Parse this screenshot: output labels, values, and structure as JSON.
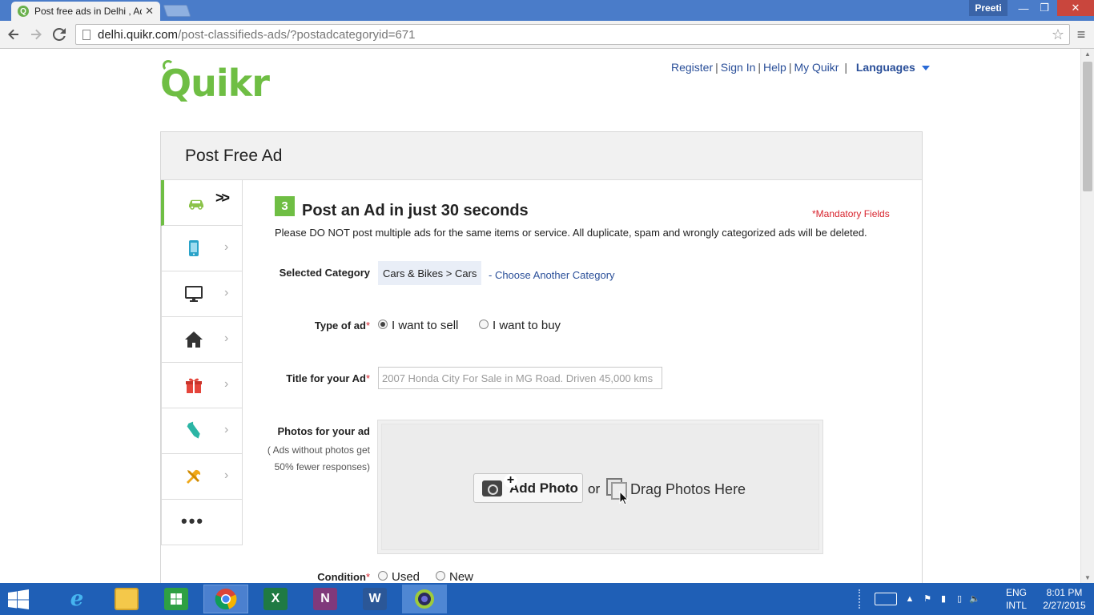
{
  "browser": {
    "tab_title": "Post free ads in Delhi , Adv",
    "tab_favicon_letter": "Q",
    "user_name": "Preeti",
    "url_host": "delhi.quikr.com",
    "url_path": "/post-classifieds-ads/?postadcategoryid=671",
    "window_controls": {
      "minimize": "—",
      "maximize": "❐",
      "close": "✕"
    }
  },
  "header": {
    "logo_text": "Quikr",
    "links": {
      "register": "Register",
      "sign_in": "Sign In",
      "help": "Help",
      "my_quikr": "My Quikr",
      "languages": "Languages"
    }
  },
  "panel": {
    "title": "Post Free Ad"
  },
  "category_nav": [
    {
      "icon": "car-icon",
      "active": true
    },
    {
      "icon": "mobile-icon",
      "active": false
    },
    {
      "icon": "monitor-icon",
      "active": false
    },
    {
      "icon": "home-icon",
      "active": false
    },
    {
      "icon": "gift-icon",
      "active": false
    },
    {
      "icon": "tie-icon",
      "active": false
    },
    {
      "icon": "tools-icon",
      "active": false
    },
    {
      "icon": "more-icon",
      "active": false,
      "label": "•••"
    }
  ],
  "form": {
    "step_number": "3",
    "heading": "Post an Ad in just 30 seconds",
    "mandatory_note": "*Mandatory Fields",
    "warning": "Please DO NOT post multiple ads for the same items or service. All duplicate, spam and wrongly categorized ads will be deleted.",
    "selected_category_label": "Selected Category",
    "selected_category_value": "Cars & Bikes > Cars",
    "choose_another": "- Choose Another Category",
    "type_of_ad_label": "Type of ad",
    "type_of_ad_options": [
      "I want to sell",
      "I want to buy"
    ],
    "type_of_ad_selected": "I want to sell",
    "title_label": "Title for your Ad",
    "title_placeholder": "2007 Honda City For Sale in MG Road. Driven 45,000 kms",
    "title_value": "",
    "photos_label": "Photos for your ad",
    "photos_note_line1": "( Ads without photos get",
    "photos_note_line2": "50% fewer responses)",
    "add_photo_button": "Add Photo",
    "or_text": "or",
    "drag_text": "Drag Photos Here",
    "condition_label": "Condition",
    "condition_options": [
      "Used",
      "New"
    ]
  },
  "taskbar": {
    "apps": [
      "internet-explorer",
      "file-explorer",
      "store",
      "chrome",
      "excel",
      "onenote",
      "word",
      "camera"
    ],
    "active_app": "chrome",
    "language_line1": "ENG",
    "language_line2": "INTL",
    "time": "8:01 PM",
    "date": "2/27/2015"
  },
  "colors": {
    "brand_green": "#6fbe44",
    "link_blue": "#2a4f99",
    "required_red": "#d8242e",
    "titlebar_blue": "#4a7cc9",
    "taskbar_blue": "#1f5fb6"
  }
}
